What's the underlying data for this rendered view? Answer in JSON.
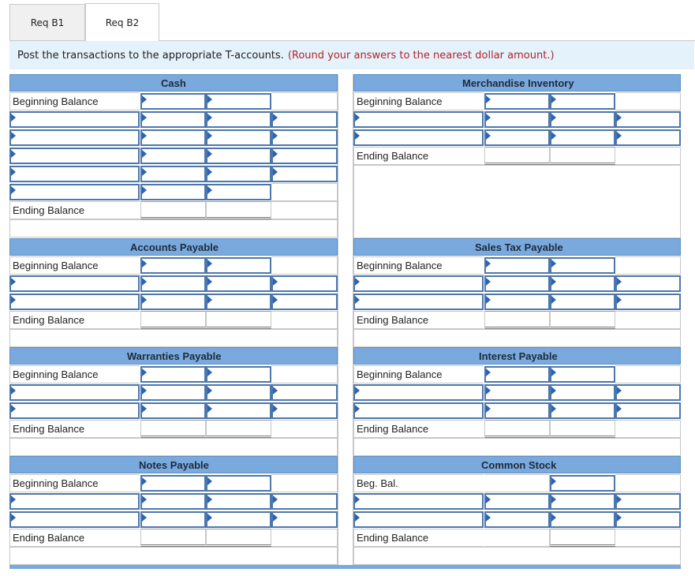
{
  "tabs": [
    {
      "label": "Req B1",
      "active": false
    },
    {
      "label": "Req B2",
      "active": true
    }
  ],
  "instruction": {
    "text": "Post the transactions to the appropriate T-accounts.",
    "note": "(Round your answers to the nearest dollar amount.)"
  },
  "labels": {
    "beginning": "Beginning Balance",
    "ending": "Ending Balance",
    "beg_short": "Beg. Bal."
  },
  "accounts": {
    "cash": "Cash",
    "merchandise_inventory": "Merchandise Inventory",
    "accounts_payable": "Accounts Payable",
    "sales_tax_payable": "Sales Tax Payable",
    "warranties_payable": "Warranties Payable",
    "interest_payable": "Interest Payable",
    "notes_payable": "Notes Payable",
    "common_stock": "Common Stock"
  },
  "colors": {
    "header": "#7aa9dd",
    "input_border": "#4d77ac",
    "note": "#b3242a",
    "instruction_bg": "#e4f2fb"
  }
}
